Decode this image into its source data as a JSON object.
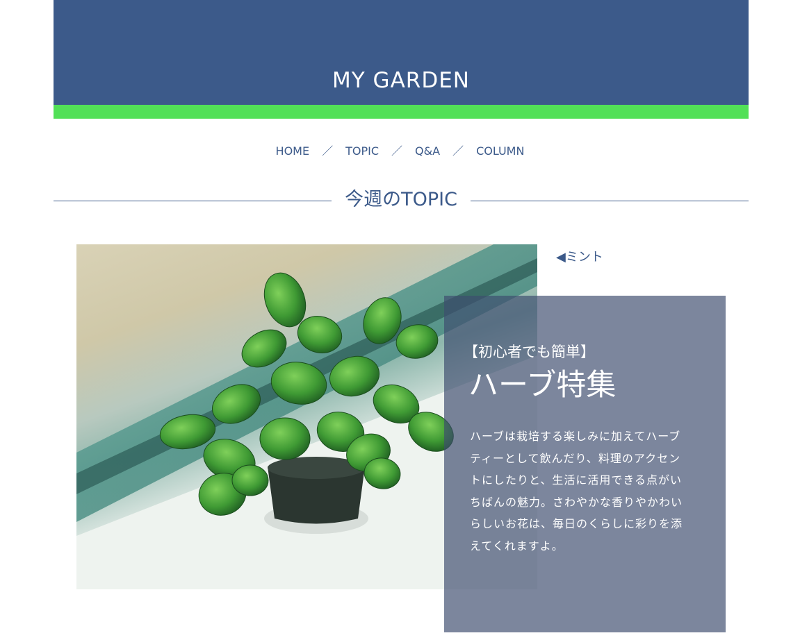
{
  "site": {
    "title": "MY GARDEN",
    "brand_color": "#3c5a8a",
    "accent_color": "#52e057"
  },
  "nav": {
    "items": [
      {
        "label": "HOME"
      },
      {
        "label": "TOPIC"
      },
      {
        "label": "Q&A"
      },
      {
        "label": "COLUMN"
      }
    ],
    "separator": "／"
  },
  "section": {
    "title": "今週のTOPIC"
  },
  "feature": {
    "image_subject": "mint-plant-photo",
    "caption": "◀ミント",
    "tag": "【初心者でも簡単】",
    "title": "ハーブ特集",
    "body_lines": [
      "ハーブは栽培する楽しみに加えてハーブ",
      "ティーとして飲んだり、料理のアクセン",
      "トにしたりと、生活に活用できる点がい",
      "ちばんの魅力。さわやかな香りやかわい",
      "らしいお花は、毎日のくらしに彩りを添",
      "えてくれますよ。"
    ],
    "overlay_color": "#3e4c6e"
  }
}
